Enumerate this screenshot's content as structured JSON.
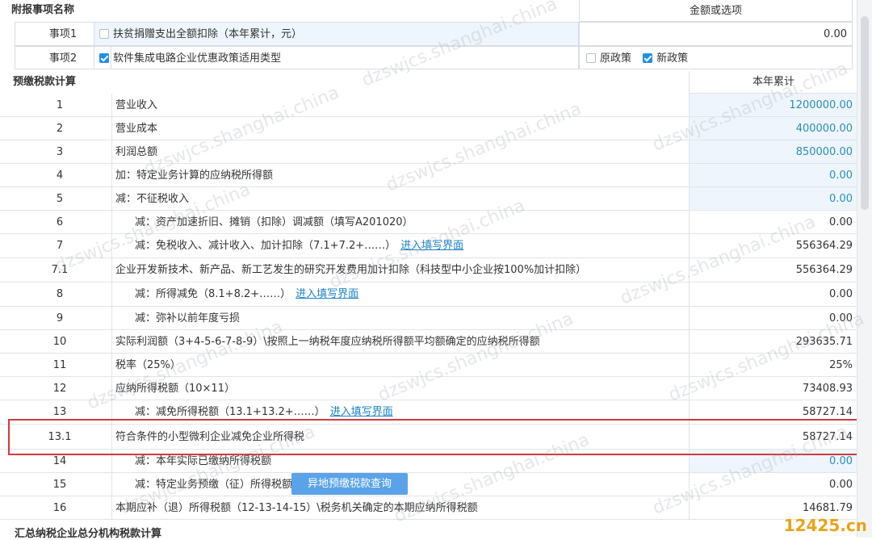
{
  "top": {
    "heading": "附报事项名称",
    "value_heading": "金额或选项",
    "items": [
      {
        "key": "事项1",
        "label": "扶贫捐赠支出全额扣除（本年累计，元）",
        "checked": false,
        "value": "0.00"
      },
      {
        "key": "事项2",
        "label": "软件集成电路企业优惠政策适用类型",
        "checked": true,
        "opt1": "原政策",
        "opt1_checked": false,
        "opt2": "新政策",
        "opt2_checked": true
      }
    ]
  },
  "calc": {
    "heading": "预缴税款计算",
    "col_heading": "本年累计",
    "link_label": "进入填写界面",
    "rows": [
      {
        "no": "1",
        "label": "营业收入",
        "value": "1200000.00",
        "input": true,
        "indent": false
      },
      {
        "no": "2",
        "label": "营业成本",
        "value": "400000.00",
        "input": true,
        "indent": false
      },
      {
        "no": "3",
        "label": "利润总额",
        "value": "850000.00",
        "input": true,
        "indent": false
      },
      {
        "no": "4",
        "label": "加：特定业务计算的应纳税所得额",
        "value": "0.00",
        "input": true,
        "indent": false
      },
      {
        "no": "5",
        "label": "减：不征税收入",
        "value": "0.00",
        "input": true,
        "indent": false
      },
      {
        "no": "6",
        "label": "减：资产加速折旧、摊销（扣除）调减额（填写A201020）",
        "value": "0.00",
        "input": false,
        "indent": true
      },
      {
        "no": "7",
        "label": "减：免税收入、减计收入、加计扣除（7.1+7.2+……）",
        "value": "556364.29",
        "input": false,
        "indent": true,
        "link": true
      },
      {
        "no": "7.1",
        "label": "企业开发新技术、新产品、新工艺发生的研究开发费用加计扣除（科技型中小企业按100%加计扣除）",
        "value": "556364.29",
        "input": false,
        "indent": false
      },
      {
        "no": "8",
        "label": "减：所得减免（8.1+8.2+……）",
        "value": "0.00",
        "input": false,
        "indent": true,
        "link": true
      },
      {
        "no": "9",
        "label": "减：弥补以前年度亏损",
        "value": "0.00",
        "input": false,
        "indent": true
      },
      {
        "no": "10",
        "label": "实际利润额（3+4-5-6-7-8-9）\\按照上一纳税年度应纳税所得额平均额确定的应纳税所得额",
        "value": "293635.71",
        "input": false,
        "indent": false
      },
      {
        "no": "11",
        "label": "税率（25%）",
        "value": "25%",
        "input": false,
        "indent": false
      },
      {
        "no": "12",
        "label": "应纳所得税额（10×11）",
        "value": "73408.93",
        "input": false,
        "indent": false
      },
      {
        "no": "13",
        "label": "减：减免所得税额（13.1+13.2+……）",
        "value": "58727.14",
        "input": false,
        "indent": true,
        "link": true
      },
      {
        "no": "13.1",
        "label": "符合条件的小型微利企业减免企业所得税",
        "value": "58727.14",
        "input": false,
        "indent": false
      },
      {
        "no": "14",
        "label": "减：本年实际已缴纳所得税额",
        "value": "0.00",
        "input": true,
        "indent": true
      },
      {
        "no": "15",
        "label": "减：特定业务预缴（征）所得税额",
        "value": "0.00",
        "input": false,
        "indent": true
      },
      {
        "no": "16",
        "label": "本期应补（退）所得税额（12-13-14-15）\\税务机关确定的本期应纳所得税额",
        "value": "14681.79",
        "input": false,
        "indent": false
      }
    ]
  },
  "popup_button": "异地预缴税款查询",
  "footer_heading": "汇总纳税企业总分机构税款计算",
  "watermark": "dzswjcs.shanghai.china",
  "brand": "12425.cn",
  "colors": {
    "accent": "#1f8fe8",
    "highlight": "#d03a3f",
    "input_bg": "#eef5fc",
    "input_text": "#2b8fb8"
  }
}
